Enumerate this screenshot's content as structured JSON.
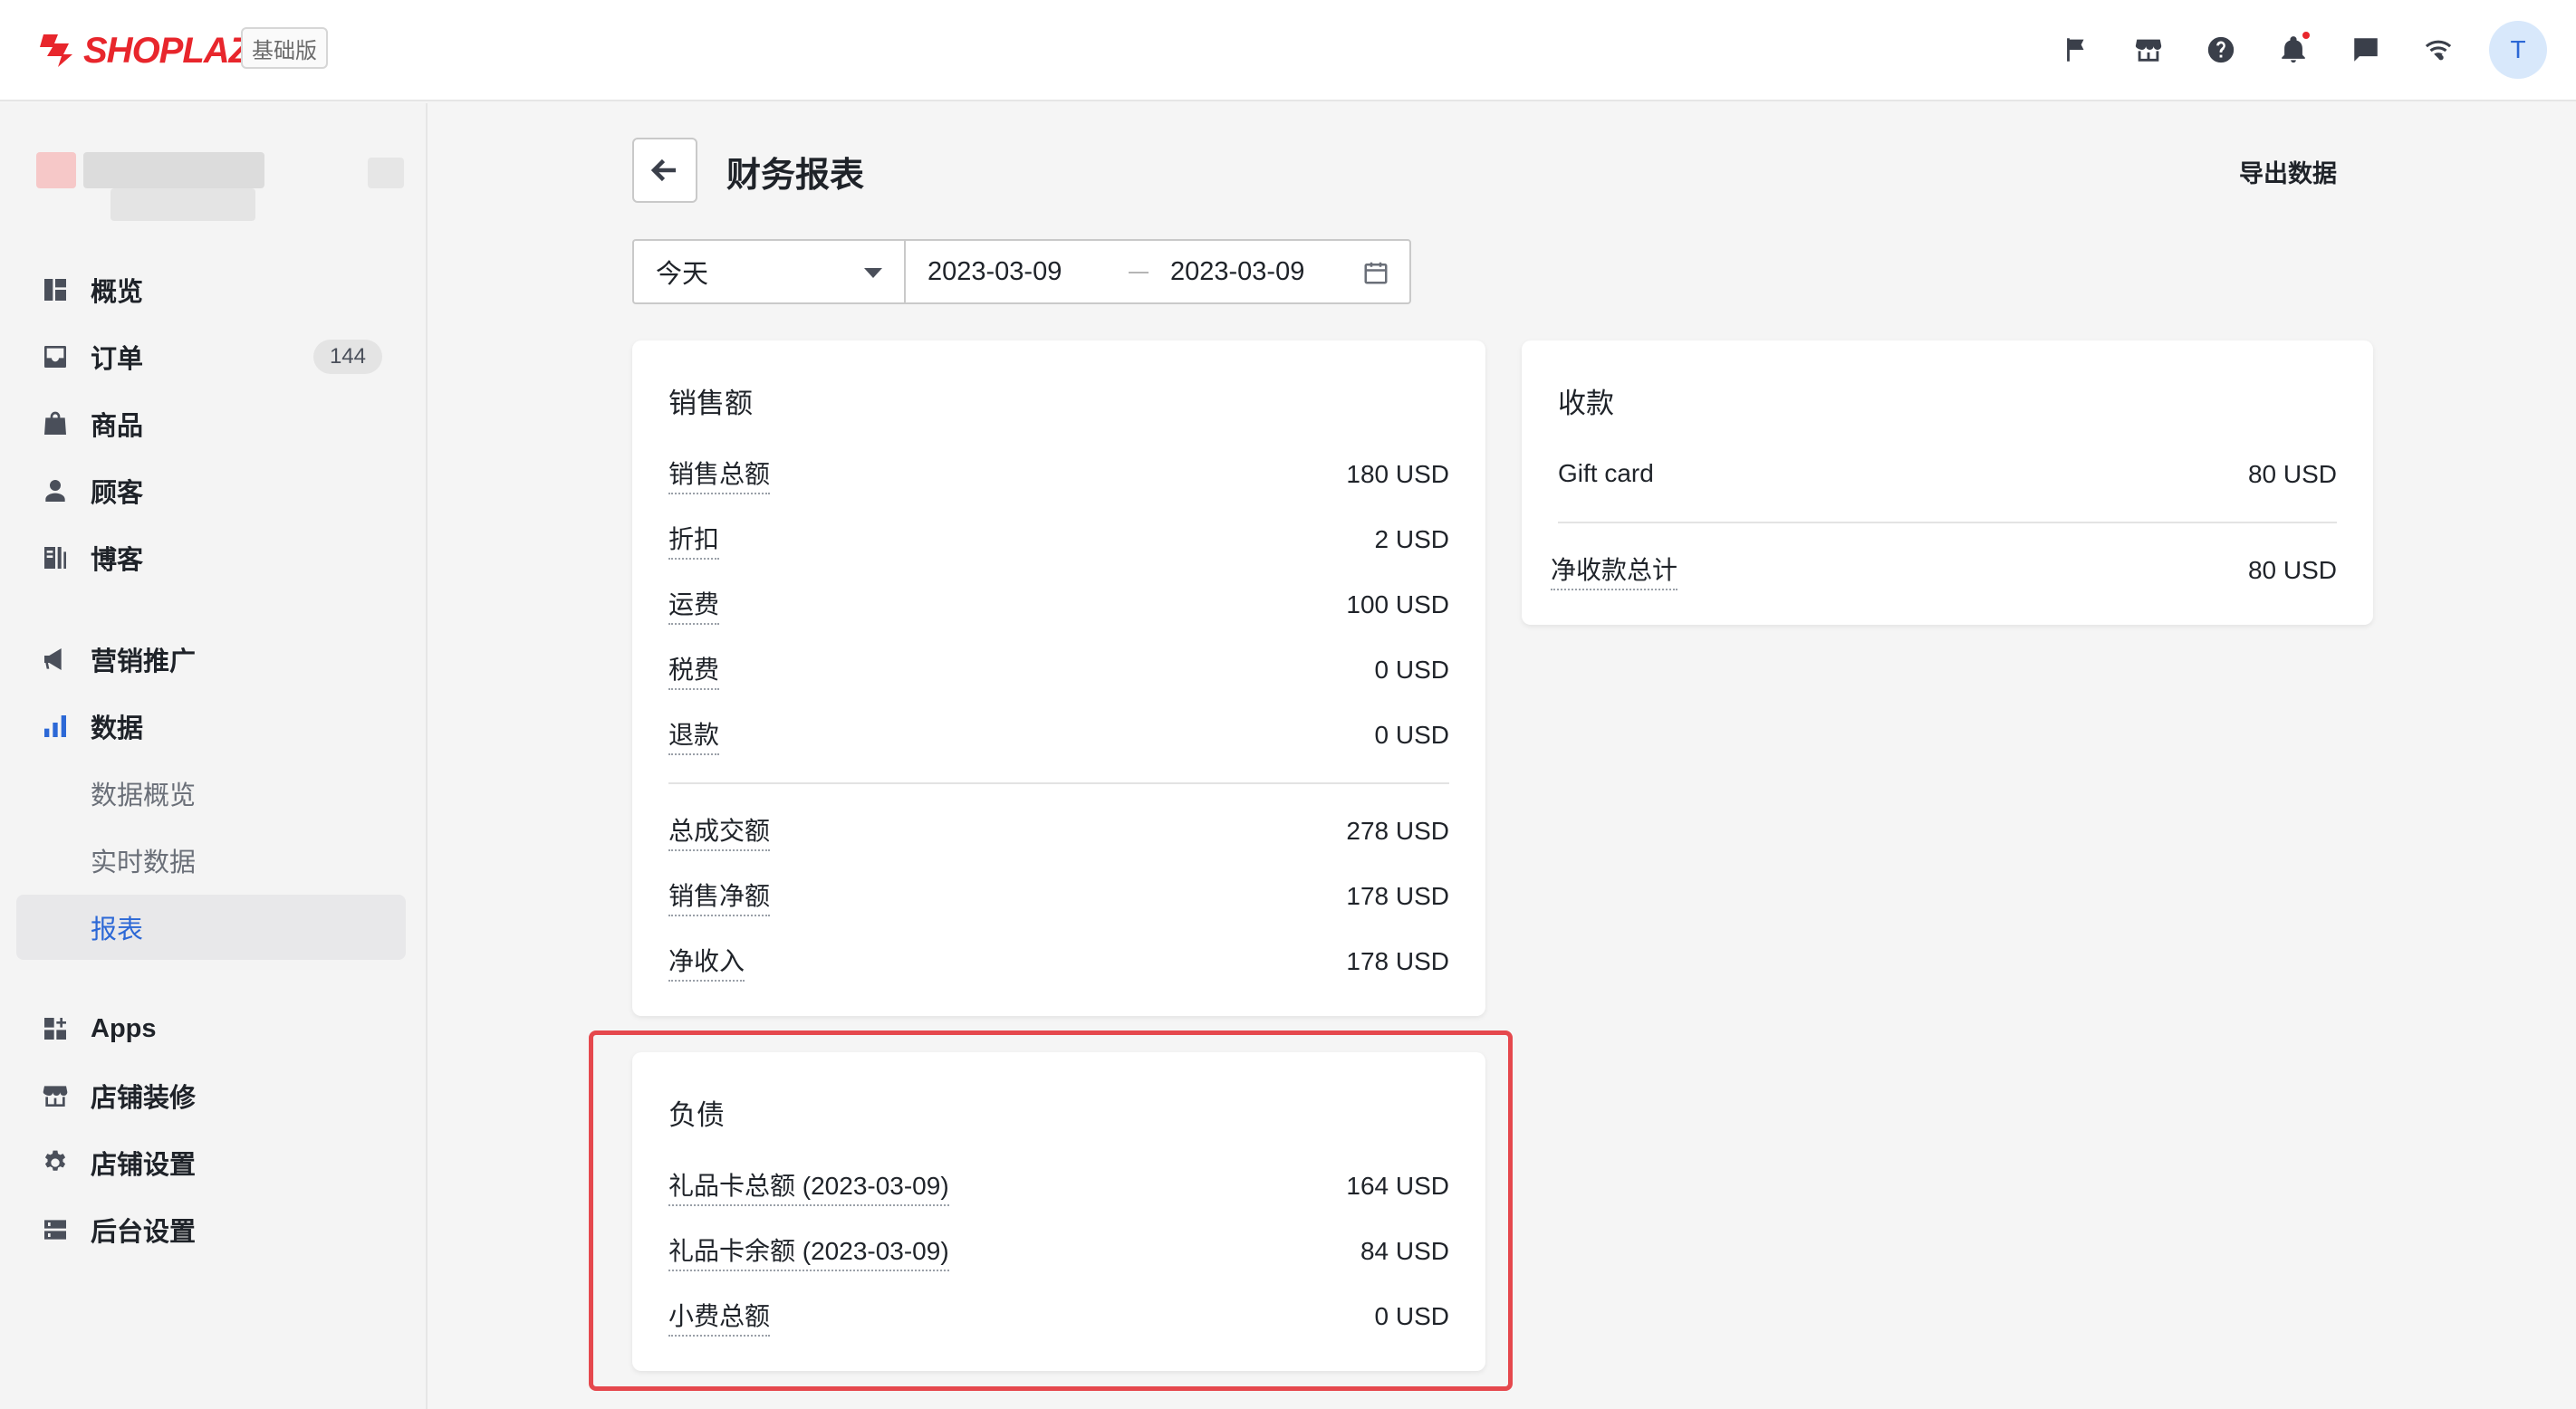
{
  "header": {
    "brand": "SHOPLAZZA",
    "plan": "基础版",
    "avatar_letter": "T"
  },
  "sidebar": {
    "items": [
      {
        "label": "概览",
        "icon": "dashboard-icon"
      },
      {
        "label": "订单",
        "icon": "inbox-icon",
        "badge": "144"
      },
      {
        "label": "商品",
        "icon": "bag-icon"
      },
      {
        "label": "顾客",
        "icon": "person-icon"
      },
      {
        "label": "博客",
        "icon": "blog-icon"
      },
      {
        "label": "营销推广",
        "icon": "megaphone-icon"
      },
      {
        "label": "数据",
        "icon": "bar-chart-icon"
      },
      {
        "label": "数据概览"
      },
      {
        "label": "实时数据"
      },
      {
        "label": "报表"
      },
      {
        "label": "Apps",
        "icon": "apps-icon"
      },
      {
        "label": "店铺装修",
        "icon": "storefront-icon"
      },
      {
        "label": "店铺设置",
        "icon": "gear-icon"
      },
      {
        "label": "后台设置",
        "icon": "server-icon"
      }
    ]
  },
  "page": {
    "title": "财务报表",
    "export_label": "导出数据"
  },
  "filter": {
    "preset": "今天",
    "start": "2023-03-09",
    "end": "2023-03-09"
  },
  "sales": {
    "title": "销售额",
    "rows": [
      {
        "label": "销售总额",
        "value": "180 USD"
      },
      {
        "label": "折扣",
        "value": "2 USD"
      },
      {
        "label": "运费",
        "value": "100 USD"
      },
      {
        "label": "税费",
        "value": "0 USD"
      },
      {
        "label": "退款",
        "value": "0 USD"
      }
    ],
    "totals": [
      {
        "label": "总成交额",
        "value": "278 USD"
      },
      {
        "label": "销售净额",
        "value": "178 USD"
      },
      {
        "label": "净收入",
        "value": "178 USD"
      }
    ]
  },
  "payments": {
    "title": "收款",
    "rows": [
      {
        "label": "Gift card",
        "value": "80 USD"
      }
    ],
    "total": {
      "label": "净收款总计",
      "value": "80 USD"
    }
  },
  "liabilities": {
    "title": "负债",
    "rows": [
      {
        "label": "礼品卡总额 (2023-03-09)",
        "value": "164 USD"
      },
      {
        "label": "礼品卡余额 (2023-03-09)",
        "value": "84 USD"
      },
      {
        "label": "小费总额",
        "value": "0 USD"
      }
    ]
  }
}
